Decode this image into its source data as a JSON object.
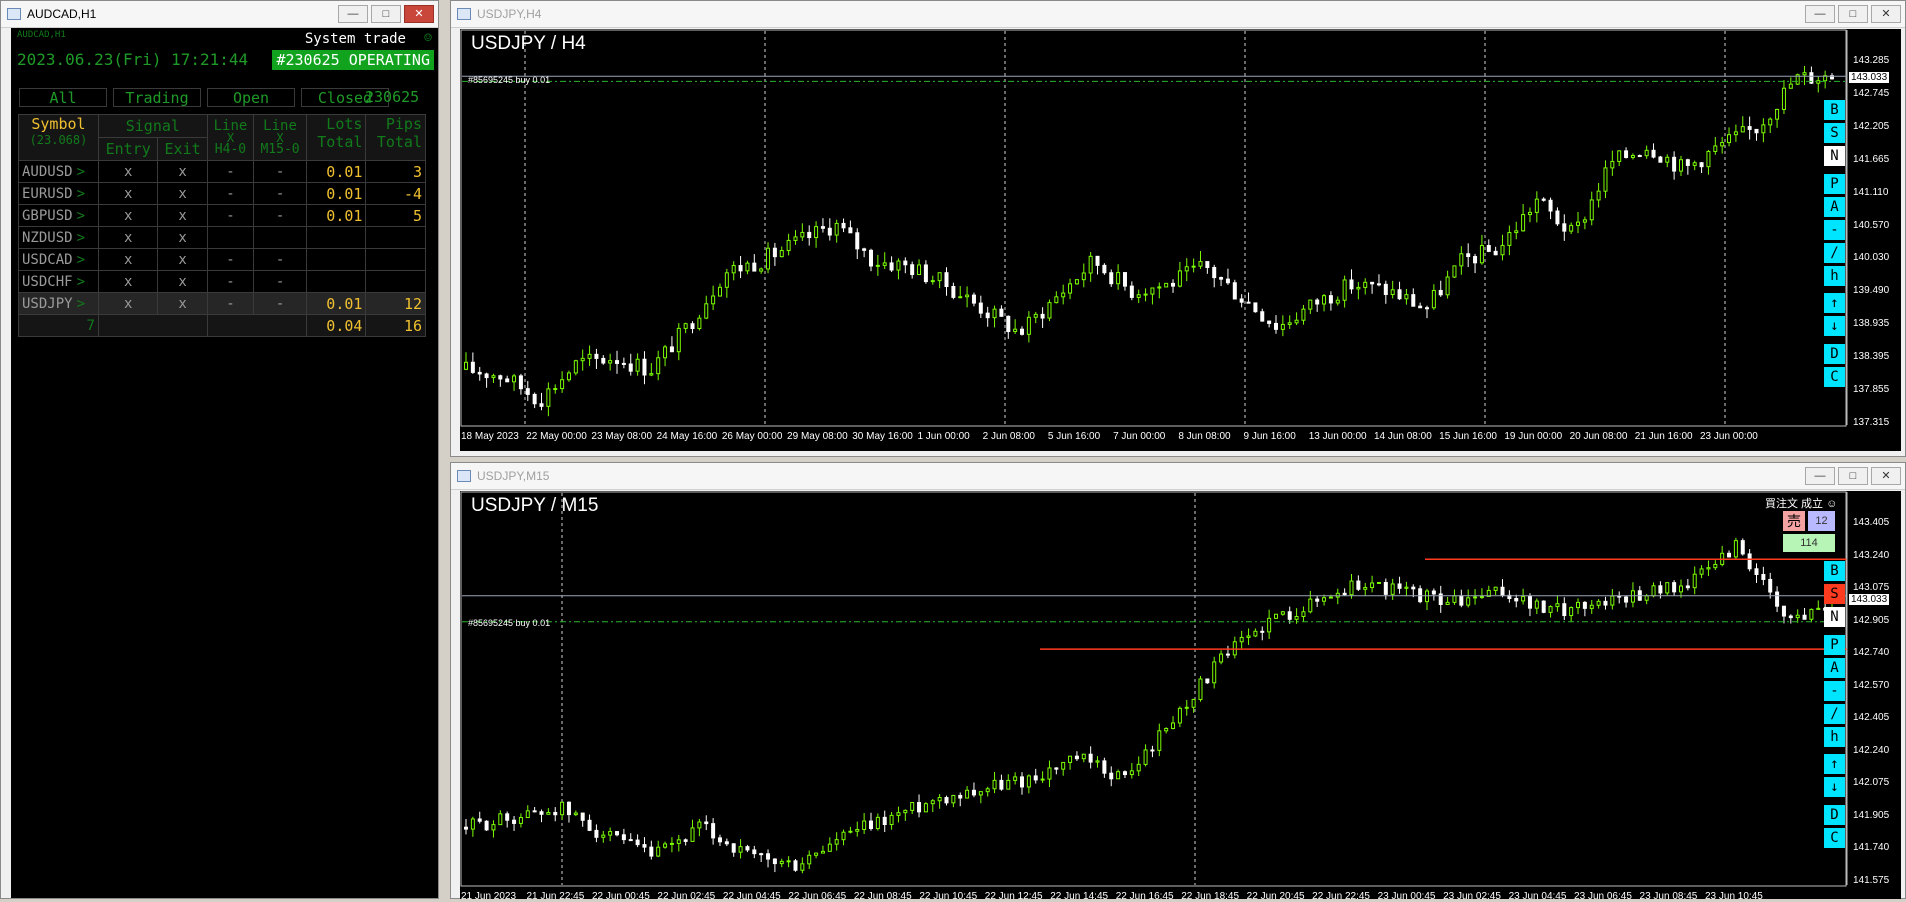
{
  "left_window": {
    "title": "AUDCAD,H1",
    "small_label": "AUDCAD,H1",
    "heading": "System trade",
    "datetime": "2023.06.23(Fri) 17:21:44",
    "status": "#230625 OPERATING",
    "tabs": [
      "All",
      "Trading",
      "Open",
      "Closed"
    ],
    "magic": "230625",
    "headers": {
      "symbol": "Symbol",
      "symbol_sub": "(23.068)",
      "signal": "Signal",
      "entry": "Entry",
      "exit": "Exit",
      "line": "Line",
      "x": "X",
      "h4": "H4-0",
      "m15": "M15-0",
      "lots": "Lots",
      "pips": "Pips",
      "total": "Total"
    },
    "rows": [
      {
        "symbol": "AUDUSD",
        "entry": "x",
        "exit": "x",
        "h4": "-",
        "m15": "-",
        "lots": "0.01",
        "pips": "3"
      },
      {
        "symbol": "EURUSD",
        "entry": "x",
        "exit": "x",
        "h4": "-",
        "m15": "-",
        "lots": "0.01",
        "pips": "-4"
      },
      {
        "symbol": "GBPUSD",
        "entry": "x",
        "exit": "x",
        "h4": "-",
        "m15": "-",
        "lots": "0.01",
        "pips": "5"
      },
      {
        "symbol": "NZDUSD",
        "entry": "x",
        "exit": "x",
        "h4": "",
        "m15": "",
        "lots": "",
        "pips": ""
      },
      {
        "symbol": "USDCAD",
        "entry": "x",
        "exit": "x",
        "h4": "-",
        "m15": "-",
        "lots": "",
        "pips": ""
      },
      {
        "symbol": "USDCHF",
        "entry": "x",
        "exit": "x",
        "h4": "-",
        "m15": "-",
        "lots": "",
        "pips": ""
      },
      {
        "symbol": "USDJPY",
        "entry": "x",
        "exit": "x",
        "h4": "-",
        "m15": "-",
        "lots": "0.01",
        "pips": "12"
      }
    ],
    "arrow": ">",
    "totals": {
      "count": "7",
      "lots": "0.04",
      "pips": "16"
    }
  },
  "h4_window": {
    "title": "USDJPY,H4",
    "chart_title": "USDJPY / H4",
    "order_label": "#85695245 buy 0.01",
    "current_price": "143.033",
    "price_ticks": [
      "143.285",
      "142.745",
      "142.205",
      "141.665",
      "141.110",
      "140.570",
      "140.030",
      "139.490",
      "138.935",
      "138.395",
      "137.855",
      "137.315"
    ],
    "time_ticks": [
      "18 May 2023",
      "22 May 00:00",
      "23 May 08:00",
      "24 May 16:00",
      "26 May 00:00",
      "29 May 08:00",
      "30 May 16:00",
      "1 Jun 00:00",
      "2 Jun 08:00",
      "5 Jun 16:00",
      "7 Jun 00:00",
      "8 Jun 08:00",
      "9 Jun 16:00",
      "13 Jun 00:00",
      "14 Jun 08:00",
      "15 Jun 16:00",
      "19 Jun 00:00",
      "20 Jun 08:00",
      "21 Jun 16:00",
      "23 Jun 00:00"
    ],
    "side_buttons": [
      "B",
      "S",
      "N",
      "P",
      "A",
      "-",
      "/",
      "h",
      "↑",
      "↓",
      "D",
      "C"
    ]
  },
  "m15_window": {
    "title": "USDJPY,M15",
    "chart_title": "USDJPY / M15",
    "order_label": "#85695245 buy 0.01",
    "current_price": "143.033",
    "price_ticks": [
      "143.405",
      "143.240",
      "143.075",
      "142.905",
      "142.740",
      "142.570",
      "142.405",
      "142.240",
      "142.075",
      "141.905",
      "141.740",
      "141.575"
    ],
    "time_ticks": [
      "21 Jun 2023",
      "21 Jun 22:45",
      "22 Jun 00:45",
      "22 Jun 02:45",
      "22 Jun 04:45",
      "22 Jun 06:45",
      "22 Jun 08:45",
      "22 Jun 10:45",
      "22 Jun 12:45",
      "22 Jun 14:45",
      "22 Jun 16:45",
      "22 Jun 18:45",
      "22 Jun 20:45",
      "22 Jun 22:45",
      "23 Jun 00:45",
      "23 Jun 02:45",
      "23 Jun 04:45",
      "23 Jun 06:45",
      "23 Jun 08:45",
      "23 Jun 10:45"
    ],
    "trade_panel": {
      "label": "買注文 成立 ☺",
      "sell": "売",
      "sell_value": "12",
      "green_value": "114"
    },
    "side_buttons": [
      "B",
      "S",
      "N",
      "P",
      "A",
      "-",
      "/",
      "h",
      "↑",
      "↓",
      "D",
      "C"
    ]
  },
  "colors": {
    "bull": "#7cfc00",
    "bear": "#ffffff",
    "grid": "#cfcfcf",
    "order_line": "#2db52d",
    "stop_line": "#ff3b1f",
    "cyan_button": "#00e5ff"
  },
  "chart_data": [
    {
      "type": "candlestick",
      "title": "USDJPY / H4",
      "ylim": [
        137.315,
        143.285
      ],
      "x_labels": [
        "18 May 2023",
        "22 May 00:00",
        "23 May 08:00",
        "24 May 16:00",
        "26 May 00:00",
        "29 May 08:00",
        "30 May 16:00",
        "1 Jun 00:00",
        "2 Jun 08:00",
        "5 Jun 16:00",
        "7 Jun 00:00",
        "8 Jun 08:00",
        "9 Jun 16:00",
        "13 Jun 00:00",
        "14 Jun 08:00",
        "15 Jun 16:00",
        "19 Jun 00:00",
        "20 Jun 08:00",
        "21 Jun 16:00",
        "23 Jun 00:00"
      ],
      "close_path": [
        138.2,
        138.1,
        137.7,
        138.3,
        138.4,
        138.2,
        138.9,
        139.8,
        140.0,
        140.3,
        140.6,
        140.0,
        139.9,
        139.6,
        139.2,
        138.8,
        139.4,
        140.0,
        139.5,
        139.6,
        139.9,
        139.4,
        138.9,
        139.3,
        139.6,
        139.5,
        139.2,
        140.0,
        140.2,
        141.0,
        140.4,
        141.6,
        141.9,
        141.5,
        141.9,
        142.2,
        143.0,
        143.05
      ],
      "order_price": 142.95,
      "current_price": 143.033
    },
    {
      "type": "candlestick",
      "title": "USDJPY / M15",
      "ylim": [
        141.575,
        143.405
      ],
      "x_labels": [
        "21 Jun 2023",
        "21 Jun 22:45",
        "22 Jun 00:45",
        "22 Jun 02:45",
        "22 Jun 04:45",
        "22 Jun 06:45",
        "22 Jun 08:45",
        "22 Jun 10:45",
        "22 Jun 12:45",
        "22 Jun 14:45",
        "22 Jun 16:45",
        "22 Jun 18:45",
        "22 Jun 20:45",
        "22 Jun 22:45",
        "23 Jun 00:45",
        "23 Jun 02:45",
        "23 Jun 04:45",
        "23 Jun 06:45",
        "23 Jun 08:45",
        "23 Jun 10:45"
      ],
      "close_path": [
        141.85,
        141.9,
        141.95,
        141.8,
        141.7,
        141.85,
        141.7,
        141.65,
        141.8,
        141.9,
        142.0,
        142.05,
        142.1,
        142.2,
        142.1,
        142.4,
        142.7,
        142.9,
        143.0,
        143.1,
        143.05,
        143.0,
        143.05,
        142.95,
        143.0,
        143.05,
        143.1,
        143.3,
        142.9,
        143.0
      ],
      "order_price": 142.9,
      "current_price": 143.033,
      "level_lines": [
        143.22,
        142.76
      ]
    }
  ]
}
